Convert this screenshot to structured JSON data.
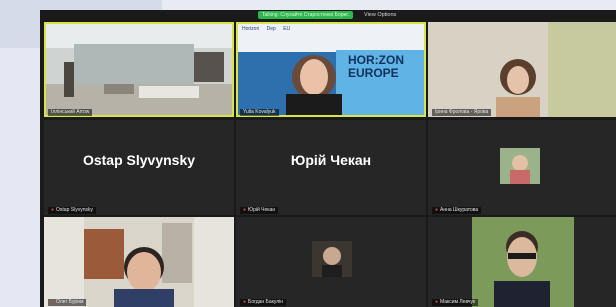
{
  "topbar": {
    "talking_text": "Talking: Слухайте Старостенко Борис",
    "view_options_label": "View Options"
  },
  "tiles": [
    {
      "name": "Іллінський Arrow",
      "muted": false
    },
    {
      "name": "Yulia Kovalyuk",
      "muted": false,
      "logos": [
        "Horizon",
        "Dep",
        "EU"
      ],
      "banner": [
        "HOR:ZON",
        "EUROPE"
      ]
    },
    {
      "name": "Ірина Фролова - Ярова",
      "muted": false
    },
    {
      "name": "Ostap Slyvynsky",
      "muted": true,
      "display_name": "Ostap Slyvynsky"
    },
    {
      "name": "Юрій Чекан",
      "muted": true,
      "display_name": "Юрій Чекан"
    },
    {
      "name": "Анна Шкуратова",
      "muted": true
    },
    {
      "name": "Олег Бурим",
      "muted": true
    },
    {
      "name": "Богдан Бакулін",
      "muted": true
    },
    {
      "name": "Максим Левчук",
      "muted": true
    }
  ],
  "colors": {
    "active_outline": "#d8e34a",
    "tile_bg": "#262626",
    "talk_green": "#2db84c"
  }
}
